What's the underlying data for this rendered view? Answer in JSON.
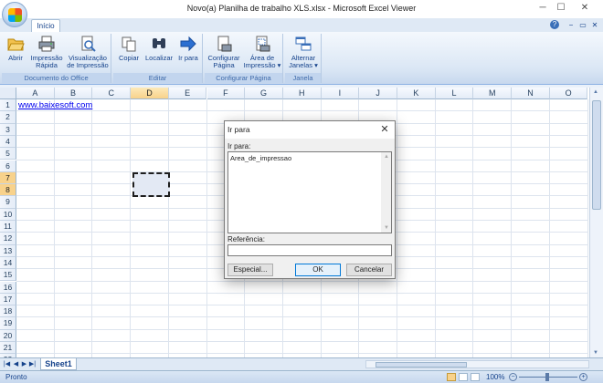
{
  "window": {
    "title": "Novo(a) Planilha de trabalho XLS.xlsx - Microsoft Excel Viewer"
  },
  "ribbon": {
    "tab": "Início",
    "groups": [
      {
        "label": "Documento do Office",
        "buttons": [
          {
            "label": "Abrir",
            "icon": "folder-open-icon"
          },
          {
            "label": "Impressão Rápida",
            "icon": "printer-icon"
          },
          {
            "label": "Visualização de Impressão",
            "icon": "print-preview-icon"
          }
        ]
      },
      {
        "label": "Editar",
        "buttons": [
          {
            "label": "Copiar",
            "icon": "copy-icon"
          },
          {
            "label": "Localizar",
            "icon": "binoculars-icon"
          },
          {
            "label": "Ir para",
            "icon": "arrow-right-icon"
          }
        ]
      },
      {
        "label": "Configurar Página",
        "buttons": [
          {
            "label": "Configurar Página",
            "icon": "page-setup-icon"
          },
          {
            "label": "Área de Impressão",
            "icon": "print-area-icon"
          }
        ]
      },
      {
        "label": "Janela",
        "buttons": [
          {
            "label": "Alternar Janelas",
            "icon": "switch-windows-icon"
          }
        ]
      }
    ]
  },
  "sheet": {
    "columns": [
      "A",
      "B",
      "C",
      "D",
      "E",
      "F",
      "G",
      "H",
      "I",
      "J",
      "K",
      "L",
      "M",
      "N",
      "O"
    ],
    "rows": [
      "1",
      "2",
      "3",
      "4",
      "5",
      "6",
      "7",
      "8",
      "9",
      "10",
      "11",
      "12",
      "13",
      "14",
      "15",
      "16",
      "17",
      "18",
      "19",
      "20",
      "21",
      "22"
    ],
    "selected_column": "D",
    "selected_rows": [
      "7",
      "8"
    ],
    "cell_a1_link": "www.baixesoft.com",
    "sheet_tab": "Sheet1"
  },
  "status": {
    "text": "Pronto",
    "zoom": "100%"
  },
  "dialog": {
    "title": "Ir para",
    "goto_label": "Ir para:",
    "list_items": [
      "Area_de_impressao"
    ],
    "reference_label": "Referência:",
    "reference_value": "",
    "special_button": "Especial...",
    "ok_button": "OK",
    "cancel_button": "Cancelar"
  }
}
